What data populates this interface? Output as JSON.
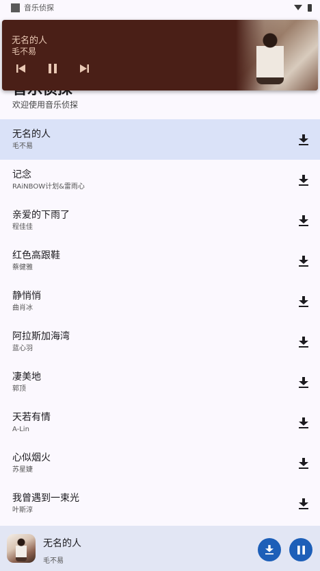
{
  "status_bar": {
    "app_name": "音乐侦探"
  },
  "notification": {
    "title": "无名的人",
    "artist": "毛不易"
  },
  "header": {
    "title": "音乐侦探",
    "subtitle": "欢迎使用音乐侦探"
  },
  "songs": [
    {
      "title": "无名的人",
      "artist": "毛不易"
    },
    {
      "title": "记念",
      "artist": "RAiNBOW计划&雷雨心"
    },
    {
      "title": "亲爱的下雨了",
      "artist": "程佳佳"
    },
    {
      "title": "红色高跟鞋",
      "artist": "蔡健雅"
    },
    {
      "title": "静悄悄",
      "artist": "曲肖冰"
    },
    {
      "title": "阿拉斯加海湾",
      "artist": "蓝心羽"
    },
    {
      "title": "凄美地",
      "artist": "郭顶"
    },
    {
      "title": "天若有情",
      "artist": "A-Lin"
    },
    {
      "title": "心似烟火",
      "artist": "苏星婕"
    },
    {
      "title": "我曾遇到一束光",
      "artist": "叶斯淳"
    }
  ],
  "player": {
    "title": "无名的人",
    "artist": "毛不易"
  },
  "colors": {
    "accent": "#1d5fb8",
    "active_row": "#dae2f8",
    "notification_bg": "#4a1f17",
    "player_bg": "#e2e6f4"
  }
}
